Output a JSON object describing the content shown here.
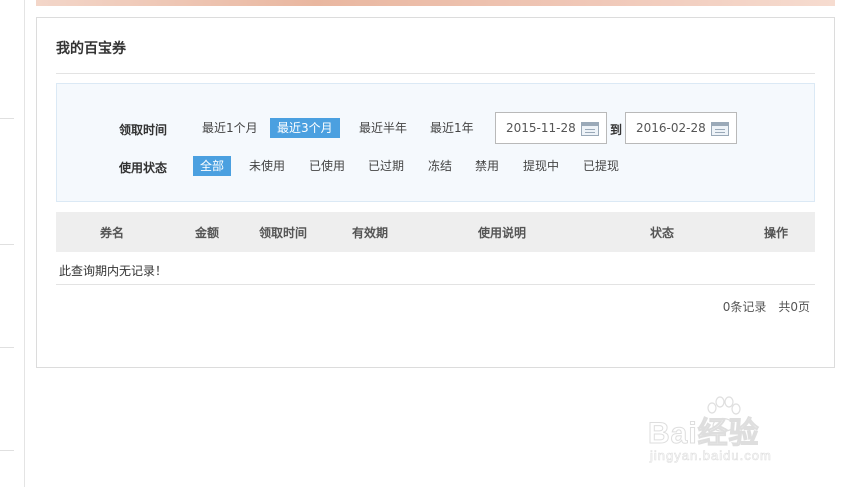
{
  "panel": {
    "title": "我的百宝券"
  },
  "filters": {
    "receive_time": {
      "label": "领取时间",
      "options": [
        "最近1个月",
        "最近3个月",
        "最近半年",
        "最近1年"
      ],
      "selected": "最近3个月",
      "date_from": "2015-11-28",
      "date_sep": "到",
      "date_to": "2016-02-28"
    },
    "use_status": {
      "label": "使用状态",
      "options": [
        "全部",
        "未使用",
        "已使用",
        "已过期",
        "冻结",
        "禁用",
        "提现中",
        "已提现"
      ],
      "selected": "全部"
    }
  },
  "table": {
    "columns": [
      "券名",
      "金额",
      "领取时间",
      "有效期",
      "使用说明",
      "状态",
      "操作"
    ],
    "rows": [],
    "empty_message": "此查询期内无记录！"
  },
  "pager": {
    "records": "0条记录",
    "pages": "共0页"
  },
  "watermark": {
    "brand": "Bai经验",
    "url": "jingyan.baidu.com"
  },
  "colors": {
    "accent": "#4ba0e0",
    "filter_bg": "#f5f9fd",
    "header_bg": "#eeeeee"
  }
}
